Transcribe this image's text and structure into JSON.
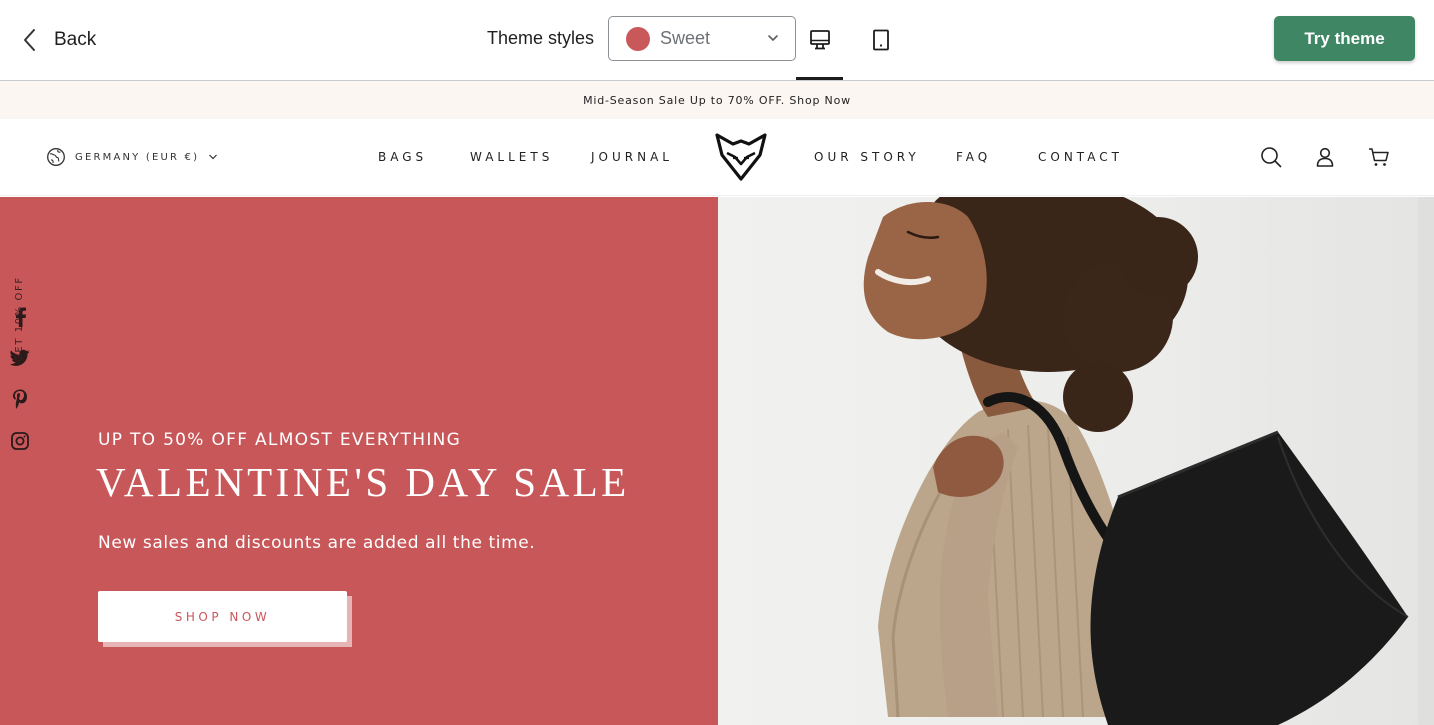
{
  "preview_bar": {
    "back_label": "Back",
    "theme_styles_label": "Theme styles",
    "selected_style": "Sweet",
    "selected_style_color": "#c9585b",
    "active_device": "desktop",
    "try_theme_label": "Try theme",
    "try_theme_color": "#3f8764"
  },
  "announcement": {
    "text": "Mid-Season Sale Up to 70% OFF. Shop Now"
  },
  "store_header": {
    "locale": "GERMANY (EUR €)",
    "nav_left": [
      "BAGS",
      "WALLETS",
      "JOURNAL"
    ],
    "nav_right": [
      "OUR STORY",
      "FAQ",
      "CONTACT"
    ],
    "icons": [
      "search-icon",
      "account-icon",
      "cart-icon"
    ]
  },
  "hero": {
    "background_color": "#c8575a",
    "eyebrow": "UP TO 50% OFF ALMOST EVERYTHING",
    "headline": "VALENTINE'S DAY SALE",
    "subtext": "New sales and discounts are added all the time.",
    "cta_label": "SHOP NOW",
    "promo_tab": "GET 10% OFF",
    "social_icons": [
      "facebook-icon",
      "twitter-icon",
      "pinterest-icon",
      "instagram-icon"
    ]
  }
}
